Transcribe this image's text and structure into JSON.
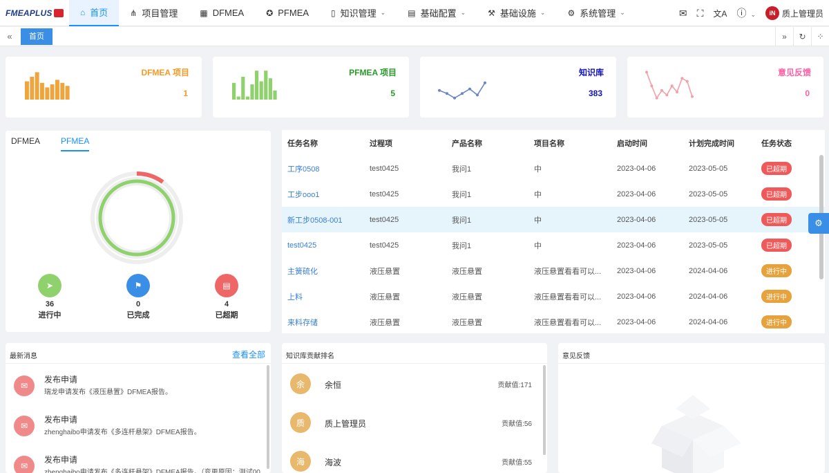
{
  "brand": {
    "name": "FMEAPLUS"
  },
  "nav": {
    "items": [
      {
        "label": "首页",
        "icon": "home-icon",
        "active": true,
        "has_dropdown": false
      },
      {
        "label": "项目管理",
        "icon": "project-tree-icon",
        "active": false,
        "has_dropdown": false
      },
      {
        "label": "DFMEA",
        "icon": "grid-icon",
        "active": false,
        "has_dropdown": false
      },
      {
        "label": "PFMEA",
        "icon": "target-icon",
        "active": false,
        "has_dropdown": false
      },
      {
        "label": "知识管理",
        "icon": "book-icon",
        "active": false,
        "has_dropdown": true
      },
      {
        "label": "基础配置",
        "icon": "calendar-icon",
        "active": false,
        "has_dropdown": true
      },
      {
        "label": "基础设施",
        "icon": "tool-icon",
        "active": false,
        "has_dropdown": true
      },
      {
        "label": "系统管理",
        "icon": "gear-icon",
        "active": false,
        "has_dropdown": true
      }
    ],
    "user": "质上管理员"
  },
  "tabs": {
    "home_label": "首页"
  },
  "stats": [
    {
      "title": "DFMEA 项目",
      "value": "1",
      "color": "#f59a23",
      "chart": "bar",
      "data": [
        0.6,
        0.75,
        0.9,
        0.55,
        0.4,
        0.5,
        0.65,
        0.55,
        0.45
      ]
    },
    {
      "title": "PFMEA 项目",
      "value": "5",
      "color": "#2a9a2a",
      "chart": "bar",
      "data": [
        0.55,
        0.1,
        0.75,
        0.1,
        0.5,
        0.95,
        0.6,
        0.95,
        0.7,
        0.3
      ]
    },
    {
      "title": "知识库",
      "value": "383",
      "color": "#1010c8",
      "chart": "line",
      "data": [
        0.3,
        0.2,
        0.05,
        0.2,
        0.35,
        0.15,
        0.55
      ]
    },
    {
      "title": "意见反馈",
      "value": "0",
      "color": "#ff5fa2",
      "chart": "line",
      "data": [
        0.9,
        0.45,
        0.05,
        0.3,
        0.15,
        0.45,
        0.25,
        0.7,
        0.6,
        0.1
      ]
    }
  ],
  "progress": {
    "tabs": [
      "DFMEA",
      "PFMEA"
    ],
    "active_tab": "PFMEA",
    "ring_colors": {
      "main": "#8fd16d",
      "over": "#ee6666",
      "track": "#eeeeee"
    },
    "items": [
      {
        "value": "36",
        "label": "进行中",
        "color": "#8fd16d",
        "icon": "send-icon"
      },
      {
        "value": "0",
        "label": "已完成",
        "color": "#3a8ee6",
        "icon": "flag-icon"
      },
      {
        "value": "4",
        "label": "已超期",
        "color": "#ee6666",
        "icon": "document-icon"
      }
    ]
  },
  "tasks": {
    "headers": [
      "任务名称",
      "过程项",
      "产品名称",
      "项目名称",
      "启动时间",
      "计划完成时间",
      "任务状态"
    ],
    "rows": [
      {
        "name": "工序0508",
        "process": "test0425",
        "product": "我问1",
        "project": "中",
        "start": "2023-04-06",
        "end": "2023-05-05",
        "status": "已超期",
        "kind": "over"
      },
      {
        "name": "工步ooo1",
        "process": "test0425",
        "product": "我问1",
        "project": "中",
        "start": "2023-04-06",
        "end": "2023-05-05",
        "status": "已超期",
        "kind": "over"
      },
      {
        "name": "新工步0508-001",
        "process": "test0425",
        "product": "我问1",
        "project": "中",
        "start": "2023-04-06",
        "end": "2023-05-05",
        "status": "已超期",
        "kind": "over"
      },
      {
        "name": "test0425",
        "process": "test0425",
        "product": "我问1",
        "project": "中",
        "start": "2023-04-06",
        "end": "2023-05-05",
        "status": "已超期",
        "kind": "over"
      },
      {
        "name": "主簧硫化",
        "process": "液压悬置",
        "product": "液压悬置",
        "project": "液压悬置看看可以...",
        "start": "2023-04-06",
        "end": "2024-04-06",
        "status": "进行中",
        "kind": "prog"
      },
      {
        "name": "上料",
        "process": "液压悬置",
        "product": "液压悬置",
        "project": "液压悬置看看可以...",
        "start": "2023-04-06",
        "end": "2024-04-06",
        "status": "进行中",
        "kind": "prog"
      },
      {
        "name": "来料存储",
        "process": "液压悬置",
        "product": "液压悬置",
        "project": "液压悬置看看可以...",
        "start": "2023-04-06",
        "end": "2024-04-06",
        "status": "进行中",
        "kind": "prog"
      }
    ]
  },
  "messages": {
    "title": "最新消息",
    "view_all": "查看全部",
    "items": [
      {
        "title": "发布申请",
        "body": "瑞龙申请发布《液压悬置》DFMEA报告。"
      },
      {
        "title": "发布申请",
        "body": "zhenghaibo申请发布《多连杆悬架》DFMEA报告。"
      },
      {
        "title": "发布申请",
        "body": "zhenghaibo申请发布《多连杆悬架》DFMEA报告。（变更原因：测试00..."
      }
    ]
  },
  "ranking": {
    "title": "知识库贡献排名",
    "items": [
      {
        "avatar": "余",
        "name": "余恒",
        "score": "贡献值:171"
      },
      {
        "avatar": "质",
        "name": "质上管理员",
        "score": "贡献值:56"
      },
      {
        "avatar": "海",
        "name": "海波",
        "score": "贡献值:55"
      }
    ]
  },
  "feedback": {
    "title": "意见反馈"
  }
}
